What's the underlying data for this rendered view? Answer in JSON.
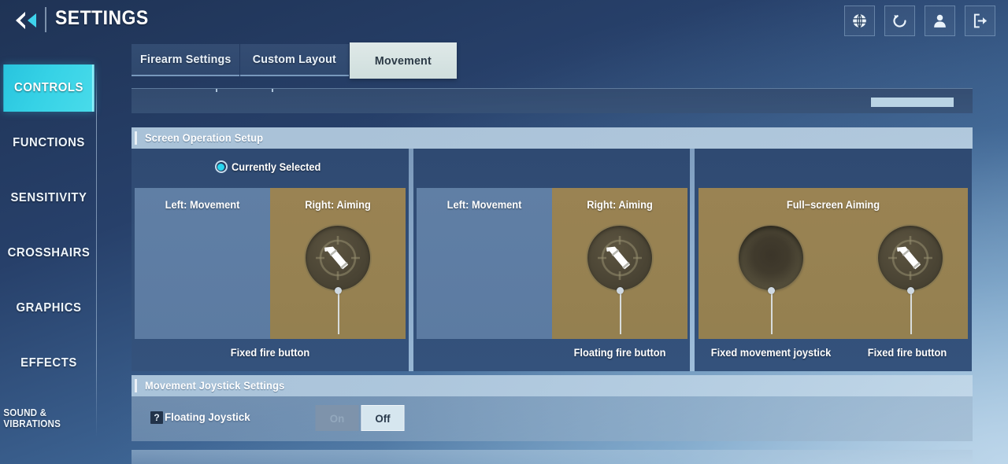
{
  "header": {
    "title": "SETTINGS",
    "back_icon": "back-arrow-icon",
    "icons": [
      {
        "name": "globe-icon",
        "label": "Language"
      },
      {
        "name": "reset-icon",
        "label": "Reset"
      },
      {
        "name": "account-icon",
        "label": "Account"
      },
      {
        "name": "logout-icon",
        "label": "Logout"
      }
    ]
  },
  "sidebar": {
    "items": [
      {
        "label": "CONTROLS",
        "active": true
      },
      {
        "label": "FUNCTIONS",
        "active": false
      },
      {
        "label": "SENSITIVITY",
        "active": false
      },
      {
        "label": "CROSSHAIRS",
        "active": false
      },
      {
        "label": "GRAPHICS",
        "active": false
      },
      {
        "label": "EFFECTS",
        "active": false
      },
      {
        "label": "SOUND & VIBRATIONS",
        "active": false
      }
    ]
  },
  "tabs": [
    {
      "label": "Firearm Settings",
      "active": false
    },
    {
      "label": "Custom Layout",
      "active": false
    },
    {
      "label": "Movement",
      "active": true
    }
  ],
  "sections": {
    "screen_operation": {
      "title": "Screen Operation Setup",
      "selected_badge": "Currently Selected",
      "options": [
        {
          "id": "fixed-fire-button",
          "selected": true,
          "panes": [
            {
              "label": "Left: Movement",
              "kind": "movement"
            },
            {
              "label": "Right: Aiming",
              "kind": "aiming"
            }
          ],
          "captions": [
            "Fixed fire button"
          ]
        },
        {
          "id": "floating-fire-button",
          "selected": false,
          "panes": [
            {
              "label": "Left: Movement",
              "kind": "movement"
            },
            {
              "label": "Right: Aiming",
              "kind": "aiming"
            }
          ],
          "captions": [
            "Floating fire button"
          ]
        },
        {
          "id": "full-screen-aiming",
          "selected": false,
          "panes": [
            {
              "label": "Full−screen Aiming",
              "kind": "full"
            }
          ],
          "captions": [
            "Fixed movement joystick",
            "Fixed fire button"
          ]
        }
      ]
    },
    "movement_joystick": {
      "title": "Movement Joystick Settings",
      "rows": [
        {
          "help_icon": "question-mark-icon",
          "label": "Floating Joystick",
          "toggle": {
            "options": [
              "On",
              "Off"
            ],
            "selected": "Off"
          }
        }
      ]
    }
  },
  "colors": {
    "accent_cyan": "#2ad6ef",
    "sidebar_active": "#36d2e6",
    "aiming_pane": "#9a8353",
    "movement_pane": "#607fa5",
    "section_header": "#b0c9de",
    "toggle_active_bg": "#d6e6ef"
  }
}
